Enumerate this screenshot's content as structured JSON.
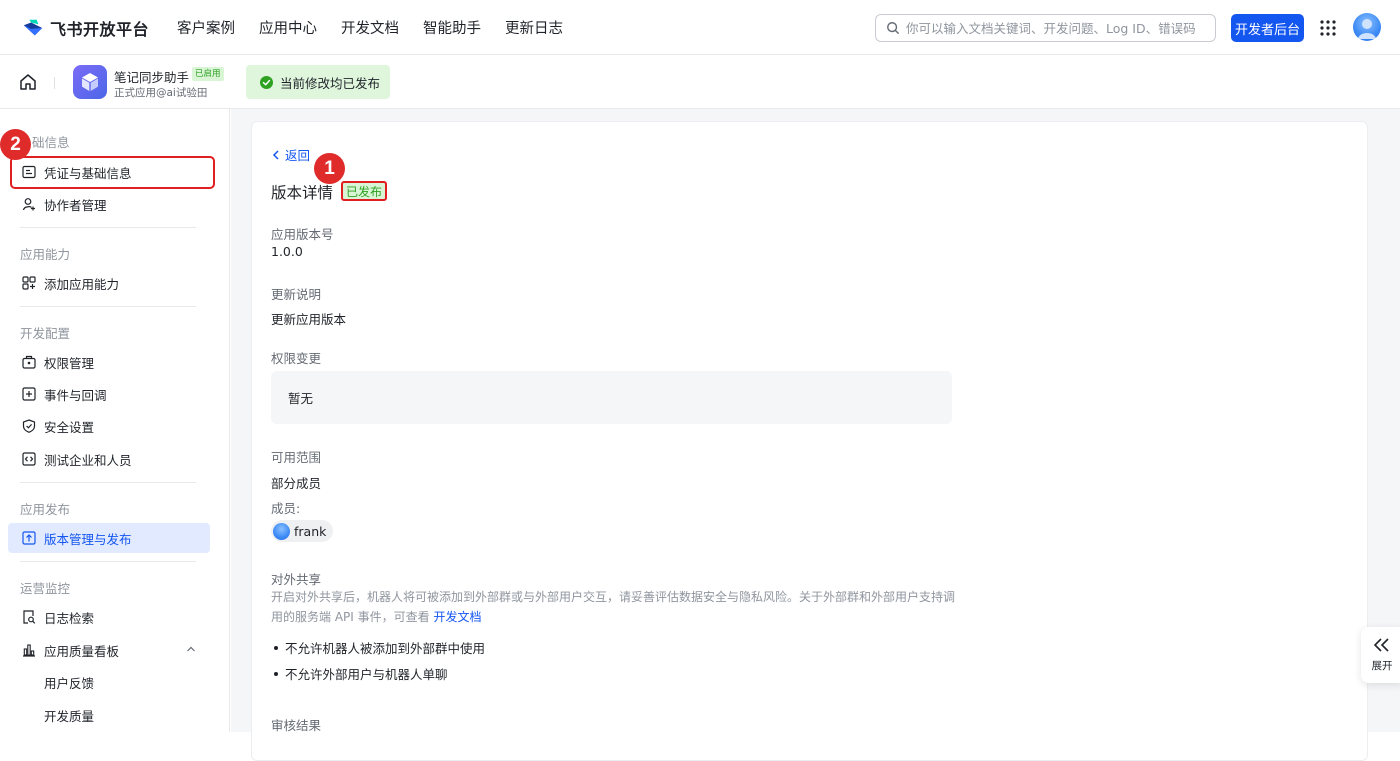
{
  "brand": {
    "name": "飞书开放平台"
  },
  "nav": {
    "links": [
      "客户案例",
      "应用中心",
      "开发文档",
      "智能助手",
      "更新日志"
    ],
    "search_placeholder": "你可以输入文档关键词、开发问题、Log ID、错误码",
    "dev_button": "开发者后台"
  },
  "app": {
    "name": "笔记同步助手",
    "status": "已启用",
    "subtitle": "正式应用@ai试验田",
    "publish_tip": "当前修改均已发布"
  },
  "sidebar": {
    "groups": [
      "基础信息",
      "应用能力",
      "开发配置",
      "应用发布",
      "运营监控"
    ],
    "items": [
      {
        "label": "凭证与基础信息"
      },
      {
        "label": "协作者管理"
      },
      {
        "label": "添加应用能力"
      },
      {
        "label": "权限管理"
      },
      {
        "label": "事件与回调"
      },
      {
        "label": "安全设置"
      },
      {
        "label": "测试企业和人员"
      },
      {
        "label": "版本管理与发布"
      },
      {
        "label": "日志检索"
      },
      {
        "label": "应用质量看板"
      },
      {
        "label": "用户反馈"
      },
      {
        "label": "开发质量"
      }
    ],
    "group_0_visible": "础信息"
  },
  "markers": [
    "1",
    "2"
  ],
  "detail": {
    "back": "返回",
    "title": "版本详情",
    "status_badge": "已发布",
    "version_label": "应用版本号",
    "version_value": "1.0.0",
    "notes_label": "更新说明",
    "notes_value": "更新应用版本",
    "perm_label": "权限变更",
    "perm_value": "暂无",
    "scope_label": "可用范围",
    "scope_value": "部分成员",
    "members_label": "成员:",
    "member_name": "frank",
    "share_label": "对外共享",
    "share_desc": "开启对外共享后，机器人将可被添加到外部群或与外部用户交互，请妥善评估数据安全与隐私风险。关于外部群和外部用户支持调用的服务端 API 事件，可查看",
    "share_link": "开发文档",
    "bullets": [
      "不允许机器人被添加到外部群中使用",
      "不允许外部用户与机器人单聊"
    ],
    "review_label": "审核结果"
  },
  "expand": {
    "label": "展开"
  },
  "colors": {
    "accent": "#1456f0",
    "success_bg": "#d9f5d6",
    "success_text": "#2ea121",
    "marker": "#e02b2b"
  }
}
